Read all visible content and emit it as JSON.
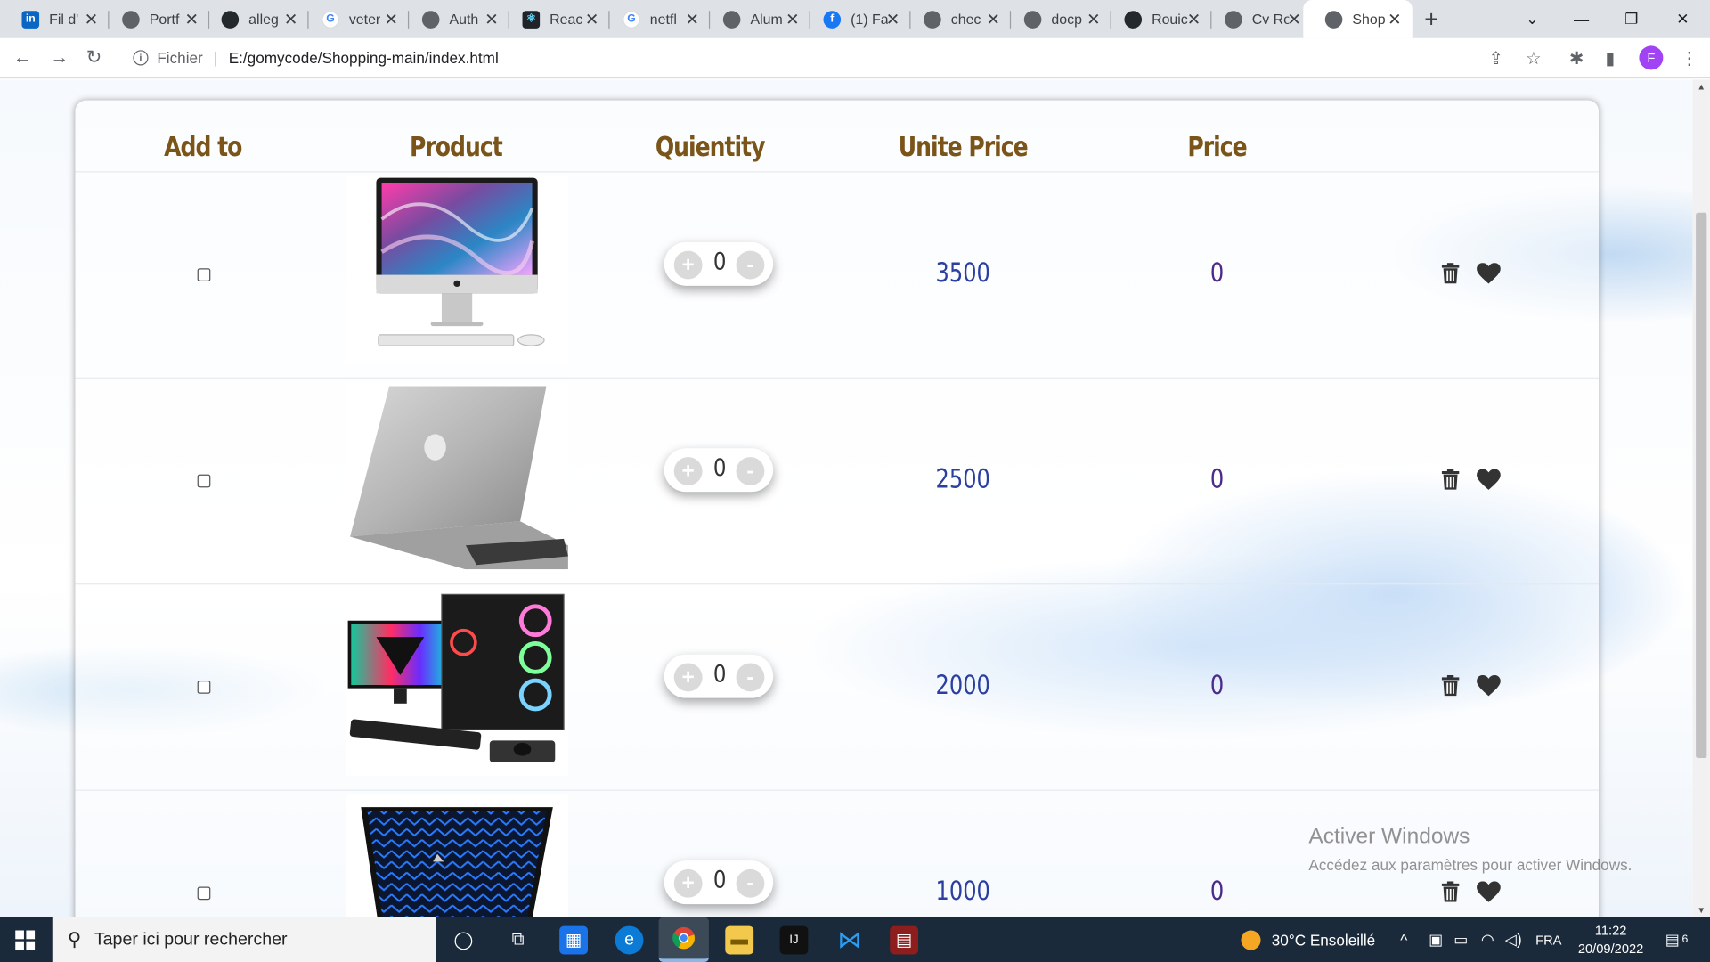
{
  "browser": {
    "tabs": [
      {
        "title": "Fil d'",
        "favicon": "linkedin-icon"
      },
      {
        "title": "Portf",
        "favicon": "globe-icon"
      },
      {
        "title": "alleg",
        "favicon": "github-icon"
      },
      {
        "title": "veter",
        "favicon": "google-icon"
      },
      {
        "title": "Auth",
        "favicon": "globe-icon"
      },
      {
        "title": "Reac",
        "favicon": "react-icon"
      },
      {
        "title": "netfl",
        "favicon": "google-icon"
      },
      {
        "title": "Alum",
        "favicon": "globe-icon"
      },
      {
        "title": "(1) Fa",
        "favicon": "facebook-icon"
      },
      {
        "title": "chec",
        "favicon": "globe-icon"
      },
      {
        "title": "docp",
        "favicon": "globe-icon"
      },
      {
        "title": "Rouic",
        "favicon": "github-icon"
      },
      {
        "title": "Cv Ro",
        "favicon": "globe-icon"
      },
      {
        "title": "Shop",
        "favicon": "globe-icon",
        "active": true
      }
    ],
    "address": {
      "scheme_label": "Fichier",
      "url": "E:/gomycode/Shopping-main/index.html"
    },
    "profile_initial": "F"
  },
  "table": {
    "headers": [
      "Add to",
      "Product",
      "Quientity",
      "Unite Price",
      "Price"
    ],
    "rows": [
      {
        "product": "iMac desktop",
        "quantity": "0",
        "unit_price": "3500",
        "price": "0"
      },
      {
        "product": "MacBook laptop",
        "quantity": "0",
        "unit_price": "2500",
        "price": "0"
      },
      {
        "product": "Gaming PC setup",
        "quantity": "0",
        "unit_price": "2000",
        "price": "0"
      },
      {
        "product": "Gaming laptop",
        "quantity": "0",
        "unit_price": "1000",
        "price": "0"
      }
    ],
    "plus_label": "+",
    "minus_label": "-"
  },
  "watermark": {
    "title": "Activer Windows",
    "subtitle": "Accédez aux paramètres pour activer Windows."
  },
  "taskbar": {
    "search_placeholder": "Taper ici pour rechercher",
    "weather": "30°C  Ensoleillé",
    "language": "FRA",
    "time": "11:22",
    "date": "20/09/2022",
    "notification_count": "6"
  }
}
